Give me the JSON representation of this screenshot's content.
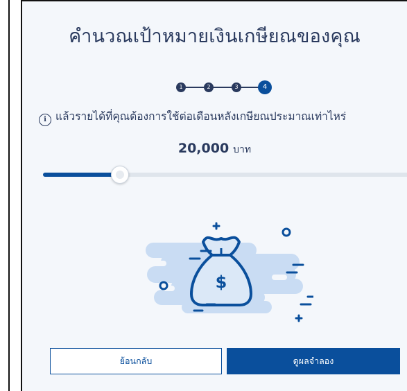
{
  "title": "คำนวณเป้าหมายเงินเกษียณของคุณ",
  "stepper": {
    "steps": [
      "1",
      "2",
      "3",
      "4"
    ],
    "current_step": 4
  },
  "question": {
    "icon": "info-icon",
    "text": "แล้วรายได้ที่คุณต้องการใช้ต่อเดือนหลังเกษียณประมาณเท่าไหร่"
  },
  "amount": {
    "value": "20,000",
    "unit": "บาท"
  },
  "slider": {
    "fraction": 0.21
  },
  "illustration": {
    "icon": "money-bag-icon"
  },
  "buttons": {
    "back": "ย้อนกลับ",
    "result": "ดูผลจำลอง"
  },
  "colors": {
    "primary": "#0a4f9c",
    "text": "#2a3a5e",
    "panel_bg": "#f4f7fb",
    "illustration_bg": "#c9dcf3"
  }
}
